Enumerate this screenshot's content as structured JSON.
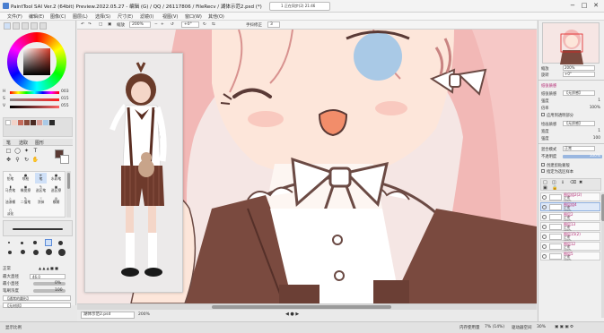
{
  "window": {
    "title": "PaintTool SAI Ver.2 (64bit) Preview.2022.05.27 - 编辑 (G) / QQ / 26117806 / FileRecv / 湖体示范2.psd (*)",
    "notification": "1 正在同步(2) 21:46",
    "minimize": "−",
    "maximize": "□",
    "close": "✕"
  },
  "menu": [
    "文件(F)",
    "编辑(E)",
    "图像(C)",
    "图层(L)",
    "选择(S)",
    "尺寸(E)",
    "滤镜(I)",
    "视图(V)",
    "窗口(W)",
    "其他(O)"
  ],
  "canvas_toolbar": {
    "zoom_label": "缩放",
    "zoom_value": "200%",
    "angle_label": "旋转",
    "angle_value": "+0°",
    "stabilizer_label": "手抖修正",
    "stabilizer_value": "3"
  },
  "color_sliders": [
    {
      "label": "H",
      "value": "003",
      "color": "#ff3b3b"
    },
    {
      "label": "S",
      "value": "015",
      "color": "#c84a4a"
    },
    {
      "label": "V",
      "value": "055",
      "color": "#7a4a4a"
    }
  ],
  "swatches": [
    "#ffffff",
    "#f0d8d0",
    "#c46a5a",
    "#8a4a3a",
    "#4a2a22",
    "#b88a80",
    "#e8c0b8",
    "#d89890",
    "#7a5a52",
    "#2a2a2a"
  ],
  "tool_tabs": [
    "笔",
    "选取",
    "图形"
  ],
  "brush_tools": [
    [
      "铅笔",
      "喷枪",
      "笔",
      "水彩笔"
    ],
    [
      "马克笔",
      "橡皮擦",
      "选区笔",
      "选区擦"
    ],
    [
      "油漆桶",
      "二值笔",
      "涂抹",
      "模糊"
    ],
    [
      "淡化",
      "",
      "",
      ""
    ]
  ],
  "brush_props": {
    "mode_label": "正常",
    "size_label": "最大直径",
    "size_value": "46.0",
    "min_size_label": "最小直径",
    "min_size_value": "0%",
    "density_label": "笔刷浓度",
    "density_value": "100",
    "shape_label": "【通常的圆形】",
    "texture_label": "【无材质】"
  },
  "file_tab": {
    "name": "湖体示范2.psd",
    "zoom": "200%"
  },
  "statusbar": {
    "left_text": "显示比例",
    "memory_label": "内存使用量",
    "memory_value": "7% (14%)",
    "drive_label": "驱动器空间",
    "drive_value": "30%"
  },
  "right_panel": {
    "navigator_zoom_label": "缩放",
    "navigator_zoom_value": "200%",
    "navigator_angle_label": "旋转",
    "navigator_angle_value": "+0°",
    "paper_effect_header": "纸张质感",
    "paper_texture_label": "纸张质感",
    "paper_texture_value": "【无质感】",
    "intensity_label": "强度",
    "intensity_value": "1",
    "scale_label": "倍率",
    "scale_value": "100%",
    "apply_label": "应用到透明部分",
    "drawing_effect_label": "绘画质感",
    "drawing_effect_value": "【无质感】",
    "width_label": "宽度",
    "width_value": "1",
    "strength_label": "强度",
    "strength_value": "100",
    "blend_label": "混合模式",
    "blend_value": "正常",
    "opacity_label": "不透明度",
    "opacity_value": "100%",
    "clip_label": "创建剪贴蒙版",
    "ref_label": "指定为选区样本"
  },
  "layers": [
    {
      "name": "图层组2(2)",
      "mode": "正常",
      "opacity": "100%"
    },
    {
      "name": "图层组4",
      "mode": "正常",
      "opacity": "100%"
    },
    {
      "name": "图层2",
      "mode": "正常",
      "opacity": "100%"
    },
    {
      "name": "图层13",
      "mode": "正常",
      "opacity": "100%"
    },
    {
      "name": "图层15(2)",
      "mode": "正常",
      "opacity": "100%"
    },
    {
      "name": "图层12",
      "mode": "正常",
      "opacity": "100%"
    },
    {
      "name": "图层5",
      "mode": "正常",
      "opacity": "100%"
    }
  ],
  "colors": {
    "accent_pink": "#b01e6d",
    "selected_fg": "#d9403a",
    "skin": "#fde6da",
    "hair": "#f2b7b5",
    "eye_blue": "#a9c9e6",
    "jacket": "#7a4a3f",
    "line": "#6b4a44"
  }
}
